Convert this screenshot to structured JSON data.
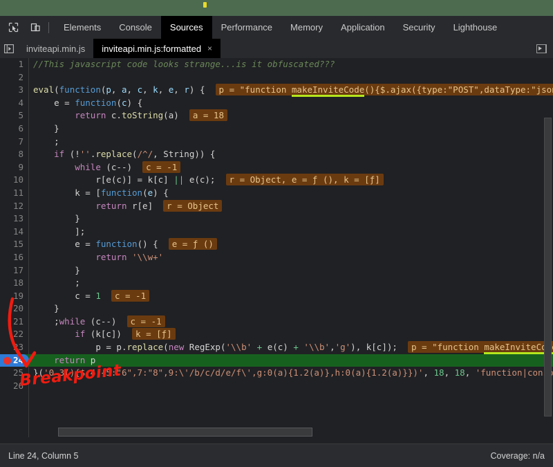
{
  "window": {
    "desktop_strip_color": "#4c6b4f",
    "accent_blue": "#2d7bd6",
    "breakpoint_red": "#e8332a",
    "current_line_green": "#17611f",
    "chip_bg": "#6b3b10",
    "underline_green": "#b5e61d"
  },
  "toolbar": {
    "icons": [
      {
        "name": "inspect-element-icon"
      },
      {
        "name": "device-toolbar-icon"
      }
    ],
    "tabs": [
      {
        "label": "Elements",
        "active": false
      },
      {
        "label": "Console",
        "active": false
      },
      {
        "label": "Sources",
        "active": true
      },
      {
        "label": "Performance",
        "active": false
      },
      {
        "label": "Memory",
        "active": false
      },
      {
        "label": "Application",
        "active": false
      },
      {
        "label": "Security",
        "active": false
      },
      {
        "label": "Lighthouse",
        "active": false
      }
    ]
  },
  "filebar": {
    "navigator_toggle": "show-navigator-icon",
    "tabs": [
      {
        "label": "inviteapi.min.js",
        "active": false,
        "closable": false
      },
      {
        "label": "inviteapi.min.js:formatted",
        "active": true,
        "closable": true,
        "close_label": "×"
      }
    ],
    "panel_toggle": "show-debugger-sidebar-icon"
  },
  "editor": {
    "first_line": 1,
    "breakpoint_line": 24,
    "current_line": 24,
    "lines": [
      {
        "n": 1,
        "indent": 0,
        "tokens": [
          {
            "t": "//This javascript code looks strange...is it obfuscated???",
            "c": "c-com"
          }
        ]
      },
      {
        "n": 2,
        "indent": 0,
        "tokens": []
      },
      {
        "n": 3,
        "indent": 0,
        "tokens": [
          {
            "t": "eval",
            "c": "c-fn"
          },
          {
            "t": "(",
            "c": "c-op"
          },
          {
            "t": "function",
            "c": "c-blue"
          },
          {
            "t": "(",
            "c": "c-op"
          },
          {
            "t": "p",
            "c": "c-par"
          },
          {
            "t": ", ",
            "c": "c-op"
          },
          {
            "t": "a",
            "c": "c-par"
          },
          {
            "t": ", ",
            "c": "c-op"
          },
          {
            "t": "c",
            "c": "c-par"
          },
          {
            "t": ", ",
            "c": "c-op"
          },
          {
            "t": "k",
            "c": "c-par"
          },
          {
            "t": ", ",
            "c": "c-op"
          },
          {
            "t": "e",
            "c": "c-par"
          },
          {
            "t": ", ",
            "c": "c-op"
          },
          {
            "t": "r",
            "c": "c-par"
          },
          {
            "t": ") {",
            "c": "c-op"
          }
        ],
        "chip": {
          "pre": "p = \"function ",
          "underline": "makeInviteCode",
          "post": "(){$.ajax({type:\"POST\",dataType:\"json\",url:\""
        }
      },
      {
        "n": 4,
        "indent": 1,
        "tokens": [
          {
            "t": "e ",
            "c": "c-id"
          },
          {
            "t": "=",
            "c": "c-op"
          },
          {
            "t": " ",
            "c": "c-op"
          },
          {
            "t": "function",
            "c": "c-blue"
          },
          {
            "t": "(",
            "c": "c-op"
          },
          {
            "t": "c",
            "c": "c-par"
          },
          {
            "t": ") {",
            "c": "c-op"
          }
        ]
      },
      {
        "n": 5,
        "indent": 2,
        "tokens": [
          {
            "t": "return",
            "c": "c-kw"
          },
          {
            "t": " c.",
            "c": "c-id"
          },
          {
            "t": "toString",
            "c": "c-fn"
          },
          {
            "t": "(a)",
            "c": "c-op"
          }
        ],
        "chip": {
          "pre": "a = 18"
        }
      },
      {
        "n": 6,
        "indent": 1,
        "tokens": [
          {
            "t": "}",
            "c": "c-op"
          }
        ]
      },
      {
        "n": 7,
        "indent": 1,
        "tokens": [
          {
            "t": ";",
            "c": "c-op"
          }
        ]
      },
      {
        "n": 8,
        "indent": 1,
        "tokens": [
          {
            "t": "if",
            "c": "c-kw"
          },
          {
            "t": " (!",
            "c": "c-op"
          },
          {
            "t": "''",
            "c": "c-str"
          },
          {
            "t": ".",
            "c": "c-op"
          },
          {
            "t": "replace",
            "c": "c-fn"
          },
          {
            "t": "(",
            "c": "c-op"
          },
          {
            "t": "/^/",
            "c": "c-str"
          },
          {
            "t": ", String)) {",
            "c": "c-op"
          }
        ]
      },
      {
        "n": 9,
        "indent": 2,
        "tokens": [
          {
            "t": "while",
            "c": "c-kw"
          },
          {
            "t": " (c--)",
            "c": "c-op"
          }
        ],
        "chip": {
          "pre": "c = -1"
        }
      },
      {
        "n": 10,
        "indent": 3,
        "tokens": [
          {
            "t": "r[",
            "c": "c-id"
          },
          {
            "t": "e",
            "c": "c-id"
          },
          {
            "t": "(c)] ",
            "c": "c-op"
          },
          {
            "t": "=",
            "c": "c-op"
          },
          {
            "t": " k[c] ",
            "c": "c-id"
          },
          {
            "t": "||",
            "c": "c-num"
          },
          {
            "t": " e(c);",
            "c": "c-id"
          }
        ],
        "chip": {
          "pre": "r = Object, e = ƒ (), k = [ƒ]"
        }
      },
      {
        "n": 11,
        "indent": 2,
        "tokens": [
          {
            "t": "k ",
            "c": "c-id"
          },
          {
            "t": "=",
            "c": "c-op"
          },
          {
            "t": " [",
            "c": "c-op"
          },
          {
            "t": "function",
            "c": "c-blue"
          },
          {
            "t": "(",
            "c": "c-op"
          },
          {
            "t": "e",
            "c": "c-par"
          },
          {
            "t": ") {",
            "c": "c-op"
          }
        ]
      },
      {
        "n": 12,
        "indent": 3,
        "tokens": [
          {
            "t": "return",
            "c": "c-kw"
          },
          {
            "t": " r[e]",
            "c": "c-id"
          }
        ],
        "chip": {
          "pre": "r = Object"
        }
      },
      {
        "n": 13,
        "indent": 2,
        "tokens": [
          {
            "t": "}",
            "c": "c-op"
          }
        ]
      },
      {
        "n": 14,
        "indent": 2,
        "tokens": [
          {
            "t": "];",
            "c": "c-op"
          }
        ]
      },
      {
        "n": 15,
        "indent": 2,
        "tokens": [
          {
            "t": "e ",
            "c": "c-id"
          },
          {
            "t": "=",
            "c": "c-op"
          },
          {
            "t": " ",
            "c": "c-op"
          },
          {
            "t": "function",
            "c": "c-blue"
          },
          {
            "t": "() {",
            "c": "c-op"
          }
        ],
        "chip": {
          "pre": "e = ƒ ()"
        }
      },
      {
        "n": 16,
        "indent": 3,
        "tokens": [
          {
            "t": "return",
            "c": "c-kw"
          },
          {
            "t": " ",
            "c": "c-op"
          },
          {
            "t": "'\\\\w+'",
            "c": "c-str"
          }
        ]
      },
      {
        "n": 17,
        "indent": 2,
        "tokens": [
          {
            "t": "}",
            "c": "c-op"
          }
        ]
      },
      {
        "n": 18,
        "indent": 2,
        "tokens": [
          {
            "t": ";",
            "c": "c-op"
          }
        ]
      },
      {
        "n": 19,
        "indent": 2,
        "tokens": [
          {
            "t": "c ",
            "c": "c-id"
          },
          {
            "t": "=",
            "c": "c-op"
          },
          {
            "t": " ",
            "c": "c-op"
          },
          {
            "t": "1",
            "c": "c-num"
          }
        ],
        "chip": {
          "pre": "c = -1"
        }
      },
      {
        "n": 20,
        "indent": 1,
        "tokens": [
          {
            "t": "}",
            "c": "c-op"
          }
        ]
      },
      {
        "n": 21,
        "indent": 1,
        "tokens": [
          {
            "t": ";",
            "c": "c-op"
          },
          {
            "t": "while",
            "c": "c-kw"
          },
          {
            "t": " (c--)",
            "c": "c-op"
          }
        ],
        "chip": {
          "pre": "c = -1"
        }
      },
      {
        "n": 22,
        "indent": 2,
        "tokens": [
          {
            "t": "if",
            "c": "c-kw"
          },
          {
            "t": " (k[c])",
            "c": "c-op"
          }
        ],
        "chip": {
          "pre": "k = [ƒ]"
        }
      },
      {
        "n": 23,
        "indent": 3,
        "tokens": [
          {
            "t": "p ",
            "c": "c-id"
          },
          {
            "t": "=",
            "c": "c-op"
          },
          {
            "t": " p.",
            "c": "c-id"
          },
          {
            "t": "replace",
            "c": "c-fn"
          },
          {
            "t": "(",
            "c": "c-op"
          },
          {
            "t": "new",
            "c": "c-kw"
          },
          {
            "t": " RegExp(",
            "c": "c-id"
          },
          {
            "t": "'\\\\b'",
            "c": "c-str"
          },
          {
            "t": " ",
            "c": "c-op"
          },
          {
            "t": "+",
            "c": "c-num"
          },
          {
            "t": " e(c) ",
            "c": "c-id"
          },
          {
            "t": "+",
            "c": "c-num"
          },
          {
            "t": " ",
            "c": "c-op"
          },
          {
            "t": "'\\\\b'",
            "c": "c-str"
          },
          {
            "t": ",",
            "c": "c-op"
          },
          {
            "t": "'g'",
            "c": "c-str"
          },
          {
            "t": "), k[c]);",
            "c": "c-id"
          }
        ],
        "chip": {
          "pre": "p = \"function ",
          "underline": "makeInviteCode",
          "post": "(){$.a"
        }
      },
      {
        "n": 24,
        "indent": 1,
        "tokens": [
          {
            "t": "return",
            "c": "c-kw"
          },
          {
            "t": " p",
            "c": "c-id"
          }
        ]
      },
      {
        "n": 25,
        "indent": 0,
        "tokens": [
          {
            "t": "}(",
            "c": "c-op"
          },
          {
            "t": "'0 3(){$.4({5:\"6\",7:\"8\",9:\\'/b/c/d/e/f\\',g:0(a){1.2(a)},h:0(a){1.2(a)}})'",
            "c": "c-str"
          },
          {
            "t": ", ",
            "c": "c-op"
          },
          {
            "t": "18",
            "c": "c-num"
          },
          {
            "t": ", ",
            "c": "c-op"
          },
          {
            "t": "18",
            "c": "c-num"
          },
          {
            "t": ", ",
            "c": "c-op"
          },
          {
            "t": "'function|console|log",
            "c": "c-str"
          }
        ]
      },
      {
        "n": 26,
        "indent": 0,
        "tokens": []
      }
    ]
  },
  "annotation": {
    "text": "Breakpoint",
    "color": "#f01b10"
  },
  "status": {
    "position": "Line 24, Column 5",
    "coverage": "Coverage: n/a"
  }
}
